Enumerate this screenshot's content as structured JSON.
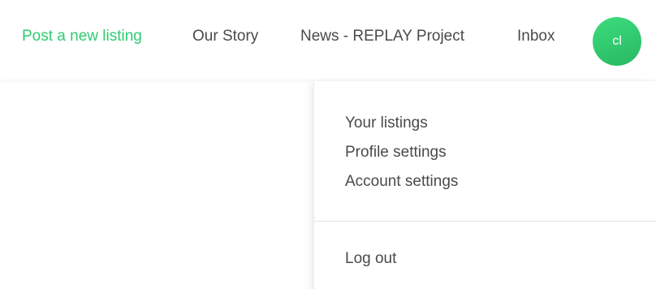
{
  "nav": {
    "links": [
      {
        "label": "Post a new listing"
      },
      {
        "label": "Our Story"
      },
      {
        "label": "News - REPLAY Project"
      },
      {
        "label": "Inbox"
      }
    ],
    "avatar_initials": "cl"
  },
  "dropdown": {
    "items": [
      {
        "label": "Your listings"
      },
      {
        "label": "Profile settings"
      },
      {
        "label": "Account settings"
      }
    ],
    "logout_label": "Log out"
  },
  "colors": {
    "accent": "#2ecc71",
    "text": "#4a4a4a"
  }
}
